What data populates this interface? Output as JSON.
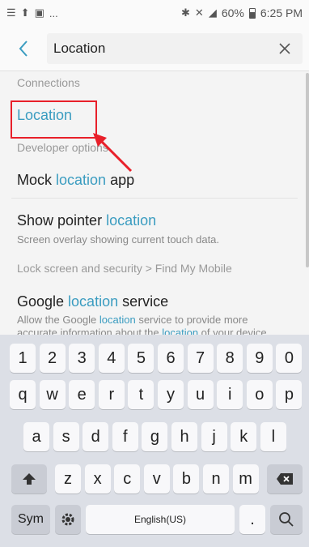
{
  "status_bar": {
    "left_icons": [
      "notifications-icon",
      "upload-icon",
      "image-icon"
    ],
    "more": "...",
    "battery": "60%",
    "time": "6:25 PM"
  },
  "search": {
    "query": "Location"
  },
  "results": [
    {
      "section": "Connections",
      "title_parts": [
        "",
        "Location",
        ""
      ],
      "subtitle": ""
    },
    {
      "section": "Developer options",
      "title_parts": [
        "Mock ",
        "location",
        " app"
      ],
      "subtitle": ""
    },
    {
      "section": "",
      "title_parts": [
        "Show pointer ",
        "location",
        ""
      ],
      "subtitle": "Screen overlay showing current touch data."
    },
    {
      "section": "Lock screen and security > Find My Mobile",
      "title_parts": [
        "Google ",
        "location",
        " service"
      ],
      "subtitle_parts": [
        "Allow the Google ",
        "location",
        " service to provide more"
      ],
      "subtitle_line2_parts": [
        "accurate information about the ",
        "location",
        " of your device."
      ]
    }
  ],
  "keyboard": {
    "row1": [
      "1",
      "2",
      "3",
      "4",
      "5",
      "6",
      "7",
      "8",
      "9",
      "0"
    ],
    "row2": [
      "q",
      "w",
      "e",
      "r",
      "t",
      "y",
      "u",
      "i",
      "o",
      "p"
    ],
    "row3": [
      "a",
      "s",
      "d",
      "f",
      "g",
      "h",
      "j",
      "k",
      "l"
    ],
    "row4": [
      "z",
      "x",
      "c",
      "v",
      "b",
      "n",
      "m"
    ],
    "sym": "Sym",
    "space": "English(US)",
    "period": "."
  },
  "colors": {
    "highlight": "#3a9cc0",
    "annotation": "#e8202a"
  }
}
